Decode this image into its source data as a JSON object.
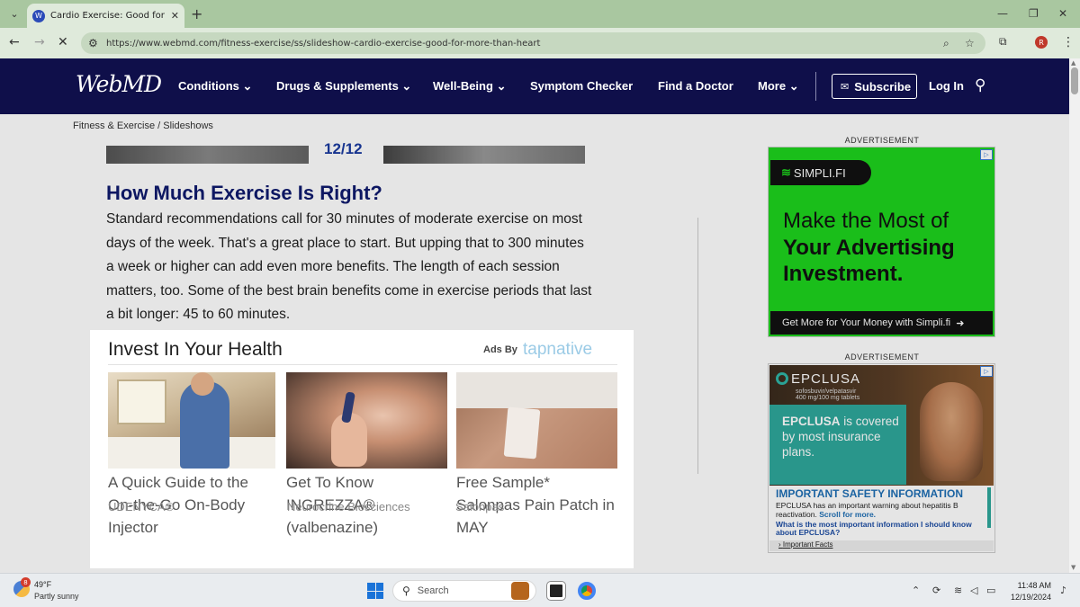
{
  "browser": {
    "tab_title": "Cardio Exercise: Good for More",
    "tab_favicon": "W",
    "url": "https://www.webmd.com/fitness-exercise/ss/slideshow-cardio-exercise-good-for-more-than-heart",
    "profile_initial": "R"
  },
  "header": {
    "logo": "WebMD",
    "nav": [
      "Conditions",
      "Drugs & Supplements",
      "Well-Being",
      "Symptom Checker",
      "Find a Doctor",
      "More"
    ],
    "subscribe": "Subscribe",
    "login": "Log In"
  },
  "breadcrumb": "Fitness & Exercise / Slideshows",
  "slide_counter": "12/12",
  "article": {
    "title": "How Much Exercise Is Right?",
    "body": "Standard recommendations call for 30 minutes of moderate exercise on most days of the week. That's a great place to start. But upping that to 300 minutes a week or higher can add even more benefits. The length of each session matters, too. Some of the best brain benefits come in exercise periods that last a bit longer: 45 to 60 minutes."
  },
  "ads": {
    "label": "ADVERTISEMENT",
    "simplifi": {
      "brand": "SIMPLI.FI",
      "headline_1": "Make the Most of",
      "headline_2": "Your Advertising Investment.",
      "cta": "Get More for Your Money with Simpli.fi"
    },
    "epclusa": {
      "brand": "EPCLUSA",
      "sub": "sofosbuvir/velpatasvir",
      "sub2": "400 mg/100 mg tablets",
      "coverage_bold": "EPCLUSA",
      "coverage_rest": " is covered by most insurance plans.",
      "isi_title": "IMPORTANT SAFETY INFORMATION",
      "isi_body": "EPCLUSA has an important warning about hepatitis B reactivation.",
      "isi_scroll": "Scroll for more.",
      "isi_question": "What is the most important information I should know about EPCLUSA?",
      "facts": "Important Facts"
    }
  },
  "tapnative": {
    "title": "Invest In Your Health",
    "ads_by": "Ads By",
    "brand": "tapnative",
    "cards": [
      {
        "headline": "A Quick Guide to the On-the-Go On-Body Injector",
        "source": "UDENYCA®"
      },
      {
        "headline": "Get To Know INGREZZA® (valbenazine)",
        "source": "Neurocrine Biosciences"
      },
      {
        "headline": "Free Sample* Salonpas Pain Patch in MAY",
        "source": "Salonpas"
      }
    ]
  },
  "taskbar": {
    "weather_badge": "8",
    "temperature": "49°F",
    "condition": "Partly sunny",
    "search": "Search",
    "time": "11:48 AM",
    "date": "12/19/2024"
  }
}
